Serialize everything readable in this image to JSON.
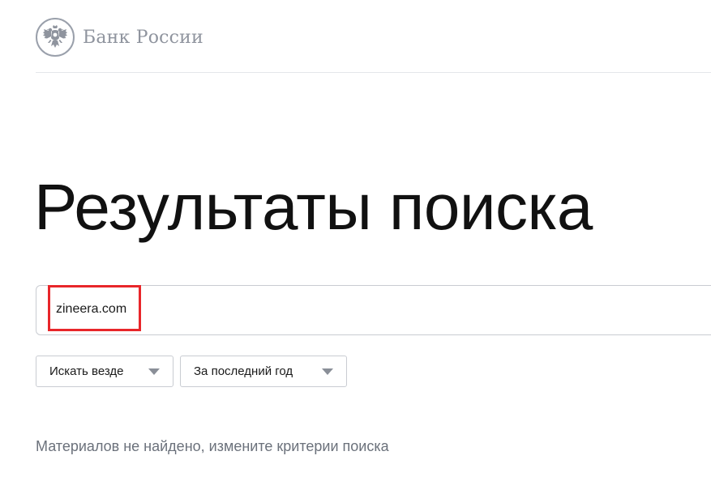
{
  "header": {
    "logo_text": "Банк России",
    "logo_icon": "double-headed-eagle-icon"
  },
  "main": {
    "title": "Результаты поиска",
    "search": {
      "value": "zineera.com",
      "placeholder": ""
    },
    "filters": {
      "where": {
        "selected": "Искать везде",
        "icon": "chevron-down-icon"
      },
      "period": {
        "selected": "За последний год",
        "icon": "chevron-down-icon"
      }
    },
    "empty_message": "Материалов не найдено, измените критерии поиска"
  },
  "annotation": {
    "highlight_color": "#e8262a"
  },
  "colors": {
    "text_primary": "#111111",
    "text_muted": "#6b717b",
    "logo_gray": "#8f949e",
    "border": "#c9ccd2"
  }
}
